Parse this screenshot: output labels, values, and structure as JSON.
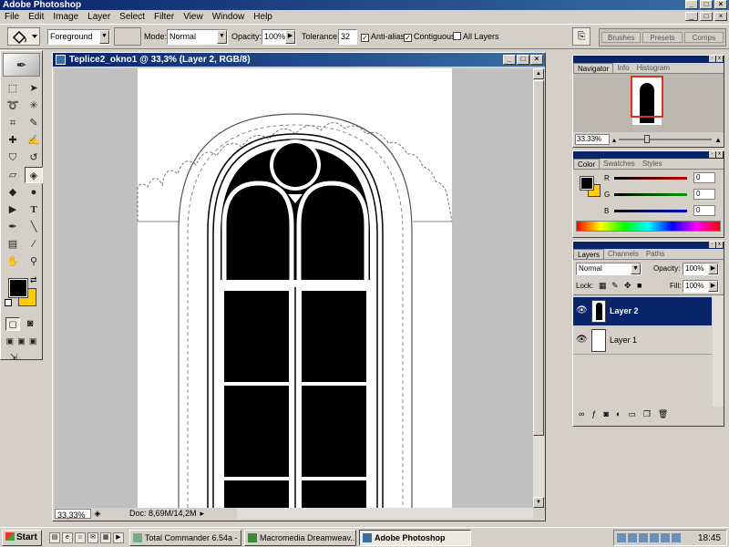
{
  "app": {
    "title": "Adobe Photoshop",
    "window_ctrls": [
      "_",
      "□",
      "×"
    ]
  },
  "menu": [
    "File",
    "Edit",
    "Image",
    "Layer",
    "Select",
    "Filter",
    "View",
    "Window",
    "Help"
  ],
  "options": {
    "fill_source": "Foreground",
    "mode_label": "Mode:",
    "mode_value": "Normal",
    "opacity_label": "Opacity:",
    "opacity_value": "100%",
    "tolerance_label": "Tolerance:",
    "tolerance_value": "32",
    "antialias_label": "Anti-alias",
    "antialias_checked": true,
    "contiguous_label": "Contiguous",
    "contiguous_checked": true,
    "alllayers_label": "All Layers",
    "alllayers_checked": false,
    "palette_tabs": [
      "Brushes",
      "Presets",
      "Comps"
    ]
  },
  "tools": {
    "active_tool": "paint-bucket",
    "foreground_color": "#000000",
    "background_color": "#ffcc00",
    "icons": [
      "marquee-icon",
      "move-icon",
      "lasso-icon",
      "magic-wand-icon",
      "crop-icon",
      "slice-icon",
      "healing-icon",
      "brush-icon",
      "stamp-icon",
      "history-brush-icon",
      "eraser-icon",
      "paint-bucket-icon",
      "blur-icon",
      "dodge-icon",
      "path-select-icon",
      "type-icon",
      "pen-icon",
      "line-icon",
      "notes-icon",
      "eyedropper-icon",
      "hand-icon",
      "zoom-icon"
    ]
  },
  "document": {
    "title": "Teplice2_okno1 @ 33,3% (Layer 2, RGB/8)",
    "zoom": "33,33%",
    "doc_info": "Doc: 8,69M/14,2M"
  },
  "navigator": {
    "tabs": [
      "Navigator",
      "Info",
      "Histogram"
    ],
    "zoom": "33.33%"
  },
  "color_panel": {
    "tabs": [
      "Color",
      "Swatches",
      "Styles"
    ],
    "sliders": [
      {
        "label": "R",
        "value": "0",
        "color": "#c00000"
      },
      {
        "label": "G",
        "value": "0",
        "color": "#00a000"
      },
      {
        "label": "B",
        "value": "0",
        "color": "#0000c0"
      }
    ]
  },
  "layers_panel": {
    "tabs": [
      "Layers",
      "Channels",
      "Paths"
    ],
    "blend_mode": "Normal",
    "opacity_label": "Opacity:",
    "opacity_value": "100%",
    "lock_label": "Lock:",
    "fill_label": "Fill:",
    "fill_value": "100%",
    "layers": [
      {
        "name": "Layer 2",
        "selected": true,
        "visible": true
      },
      {
        "name": "Layer 1",
        "selected": false,
        "visible": true
      }
    ]
  },
  "taskbar": {
    "start": "Start",
    "buttons": [
      {
        "label": "Total Commander 6.54a - ...",
        "active": false
      },
      {
        "label": "Macromedia Dreamweav...",
        "active": false
      },
      {
        "label": "Adobe Photoshop",
        "active": true
      }
    ],
    "clock": "18:45"
  }
}
